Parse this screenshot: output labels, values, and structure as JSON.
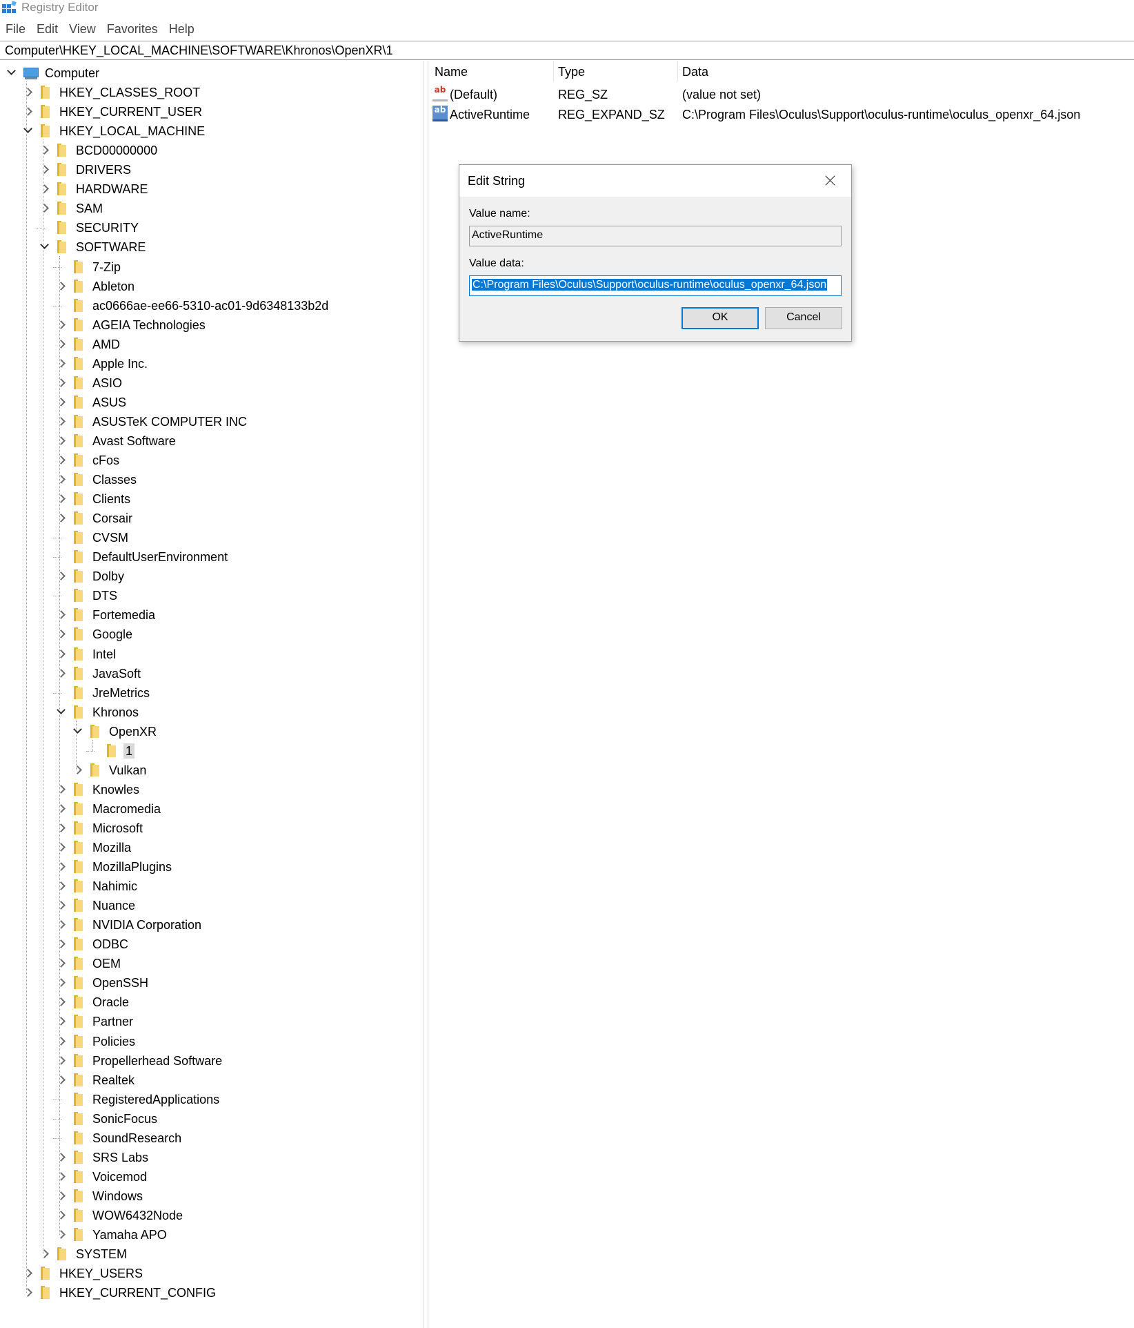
{
  "window": {
    "title": "Registry Editor",
    "icon": "regedit-icon"
  },
  "menu": [
    "File",
    "Edit",
    "View",
    "Favorites",
    "Help"
  ],
  "address": "Computer\\HKEY_LOCAL_MACHINE\\SOFTWARE\\Khronos\\OpenXR\\1",
  "tree": [
    {
      "label": "Computer",
      "level": 0,
      "state": "expanded",
      "icon": "computer-icon"
    },
    {
      "label": "HKEY_CLASSES_ROOT",
      "level": 1,
      "state": "collapsed"
    },
    {
      "label": "HKEY_CURRENT_USER",
      "level": 1,
      "state": "collapsed"
    },
    {
      "label": "HKEY_LOCAL_MACHINE",
      "level": 1,
      "state": "expanded"
    },
    {
      "label": "BCD00000000",
      "level": 2,
      "state": "collapsed"
    },
    {
      "label": "DRIVERS",
      "level": 2,
      "state": "collapsed"
    },
    {
      "label": "HARDWARE",
      "level": 2,
      "state": "collapsed"
    },
    {
      "label": "SAM",
      "level": 2,
      "state": "collapsed"
    },
    {
      "label": "SECURITY",
      "level": 2,
      "state": "none"
    },
    {
      "label": "SOFTWARE",
      "level": 2,
      "state": "expanded"
    },
    {
      "label": "7-Zip",
      "level": 3,
      "state": "none"
    },
    {
      "label": "Ableton",
      "level": 3,
      "state": "collapsed"
    },
    {
      "label": "ac0666ae-ee66-5310-ac01-9d6348133b2d",
      "level": 3,
      "state": "none"
    },
    {
      "label": "AGEIA Technologies",
      "level": 3,
      "state": "collapsed"
    },
    {
      "label": "AMD",
      "level": 3,
      "state": "collapsed"
    },
    {
      "label": "Apple Inc.",
      "level": 3,
      "state": "collapsed"
    },
    {
      "label": "ASIO",
      "level": 3,
      "state": "collapsed"
    },
    {
      "label": "ASUS",
      "level": 3,
      "state": "collapsed"
    },
    {
      "label": "ASUSTeK COMPUTER INC",
      "level": 3,
      "state": "collapsed"
    },
    {
      "label": "Avast Software",
      "level": 3,
      "state": "collapsed"
    },
    {
      "label": "cFos",
      "level": 3,
      "state": "collapsed"
    },
    {
      "label": "Classes",
      "level": 3,
      "state": "collapsed"
    },
    {
      "label": "Clients",
      "level": 3,
      "state": "collapsed"
    },
    {
      "label": "Corsair",
      "level": 3,
      "state": "collapsed"
    },
    {
      "label": "CVSM",
      "level": 3,
      "state": "none"
    },
    {
      "label": "DefaultUserEnvironment",
      "level": 3,
      "state": "none"
    },
    {
      "label": "Dolby",
      "level": 3,
      "state": "collapsed"
    },
    {
      "label": "DTS",
      "level": 3,
      "state": "none"
    },
    {
      "label": "Fortemedia",
      "level": 3,
      "state": "collapsed"
    },
    {
      "label": "Google",
      "level": 3,
      "state": "collapsed"
    },
    {
      "label": "Intel",
      "level": 3,
      "state": "collapsed"
    },
    {
      "label": "JavaSoft",
      "level": 3,
      "state": "collapsed"
    },
    {
      "label": "JreMetrics",
      "level": 3,
      "state": "none"
    },
    {
      "label": "Khronos",
      "level": 3,
      "state": "expanded"
    },
    {
      "label": "OpenXR",
      "level": 4,
      "state": "expanded"
    },
    {
      "label": "1",
      "level": 5,
      "state": "none",
      "selected": true
    },
    {
      "label": "Vulkan",
      "level": 4,
      "state": "collapsed"
    },
    {
      "label": "Knowles",
      "level": 3,
      "state": "collapsed"
    },
    {
      "label": "Macromedia",
      "level": 3,
      "state": "collapsed"
    },
    {
      "label": "Microsoft",
      "level": 3,
      "state": "collapsed"
    },
    {
      "label": "Mozilla",
      "level": 3,
      "state": "collapsed"
    },
    {
      "label": "MozillaPlugins",
      "level": 3,
      "state": "collapsed"
    },
    {
      "label": "Nahimic",
      "level": 3,
      "state": "collapsed"
    },
    {
      "label": "Nuance",
      "level": 3,
      "state": "collapsed"
    },
    {
      "label": "NVIDIA Corporation",
      "level": 3,
      "state": "collapsed"
    },
    {
      "label": "ODBC",
      "level": 3,
      "state": "collapsed"
    },
    {
      "label": "OEM",
      "level": 3,
      "state": "collapsed"
    },
    {
      "label": "OpenSSH",
      "level": 3,
      "state": "collapsed"
    },
    {
      "label": "Oracle",
      "level": 3,
      "state": "collapsed"
    },
    {
      "label": "Partner",
      "level": 3,
      "state": "collapsed"
    },
    {
      "label": "Policies",
      "level": 3,
      "state": "collapsed"
    },
    {
      "label": "Propellerhead Software",
      "level": 3,
      "state": "collapsed"
    },
    {
      "label": "Realtek",
      "level": 3,
      "state": "collapsed"
    },
    {
      "label": "RegisteredApplications",
      "level": 3,
      "state": "none"
    },
    {
      "label": "SonicFocus",
      "level": 3,
      "state": "none"
    },
    {
      "label": "SoundResearch",
      "level": 3,
      "state": "none"
    },
    {
      "label": "SRS Labs",
      "level": 3,
      "state": "collapsed"
    },
    {
      "label": "Voicemod",
      "level": 3,
      "state": "collapsed"
    },
    {
      "label": "Windows",
      "level": 3,
      "state": "collapsed"
    },
    {
      "label": "WOW6432Node",
      "level": 3,
      "state": "collapsed"
    },
    {
      "label": "Yamaha APO",
      "level": 3,
      "state": "collapsed"
    },
    {
      "label": "SYSTEM",
      "level": 2,
      "state": "collapsed"
    },
    {
      "label": "HKEY_USERS",
      "level": 1,
      "state": "collapsed"
    },
    {
      "label": "HKEY_CURRENT_CONFIG",
      "level": 1,
      "state": "collapsed"
    }
  ],
  "values": {
    "columns": [
      "Name",
      "Type",
      "Data"
    ],
    "rows": [
      {
        "name": "(Default)",
        "type": "REG_SZ",
        "data": "(value not set)",
        "icon": "string-value-icon"
      },
      {
        "name": "ActiveRuntime",
        "type": "REG_EXPAND_SZ",
        "data": "C:\\Program Files\\Oculus\\Support\\oculus-runtime\\oculus_openxr_64.json",
        "icon": "expand-string-value-icon"
      }
    ]
  },
  "dialog": {
    "title": "Edit String",
    "value_name_label": "Value name:",
    "value_name": "ActiveRuntime",
    "value_data_label": "Value data:",
    "value_data": "C:\\Program Files\\Oculus\\Support\\oculus-runtime\\oculus_openxr_64.json",
    "ok_label": "OK",
    "cancel_label": "Cancel"
  }
}
